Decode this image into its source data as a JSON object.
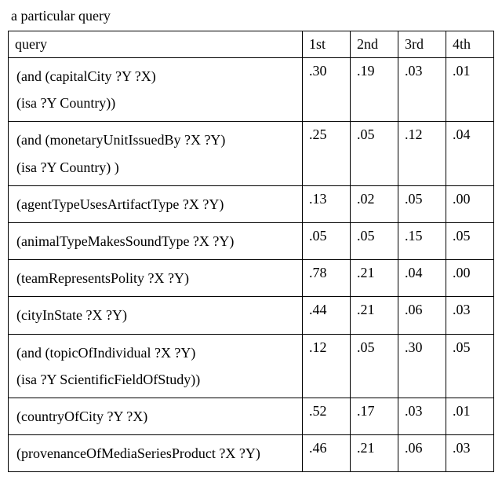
{
  "caption": "a particular query",
  "headers": {
    "query": "query",
    "c1": "1st",
    "c2": "2nd",
    "c3": "3rd",
    "c4": "4th"
  },
  "chart_data": {
    "type": "table",
    "columns": [
      "query",
      "1st",
      "2nd",
      "3rd",
      "4th"
    ],
    "rows": [
      {
        "query_lines": [
          "(and (capitalCity ?Y ?X)",
          "(isa ?Y Country))"
        ],
        "c1": ".30",
        "c2": ".19",
        "c3": ".03",
        "c4": ".01"
      },
      {
        "query_lines": [
          "(and (monetaryUnitIssuedBy ?X ?Y)",
          "(isa ?Y Country) )"
        ],
        "c1": ".25",
        "c2": ".05",
        "c3": ".12",
        "c4": ".04"
      },
      {
        "query_lines": [
          "(agentTypeUsesArtifactType ?X ?Y)"
        ],
        "c1": ".13",
        "c2": ".02",
        "c3": ".05",
        "c4": ".00"
      },
      {
        "query_lines": [
          "(animalTypeMakesSoundType ?X ?Y)"
        ],
        "c1": ".05",
        "c2": ".05",
        "c3": ".15",
        "c4": ".05"
      },
      {
        "query_lines": [
          "(teamRepresentsPolity ?X ?Y)"
        ],
        "c1": ".78",
        "c2": ".21",
        "c3": ".04",
        "c4": ".00"
      },
      {
        "query_lines": [
          "(cityInState ?X ?Y)"
        ],
        "c1": ".44",
        "c2": ".21",
        "c3": ".06",
        "c4": ".03"
      },
      {
        "query_lines": [
          "(and (topicOfIndividual ?X ?Y)",
          "(isa ?Y ScientificFieldOfStudy))"
        ],
        "c1": ".12",
        "c2": ".05",
        "c3": ".30",
        "c4": ".05"
      },
      {
        "query_lines": [
          "(countryOfCity ?Y ?X)"
        ],
        "c1": ".52",
        "c2": ".17",
        "c3": ".03",
        "c4": ".01"
      },
      {
        "query_lines": [
          "(provenanceOfMediaSeriesProduct ?X ?Y)"
        ],
        "c1": ".46",
        "c2": ".21",
        "c3": ".06",
        "c4": ".03"
      }
    ]
  }
}
